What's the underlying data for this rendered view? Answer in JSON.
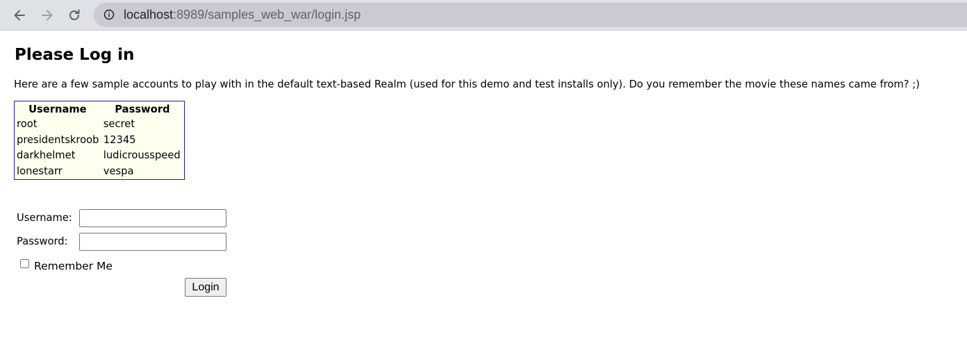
{
  "browser": {
    "url_host": "localhost",
    "url_path": ":8989/samples_web_war/login.jsp",
    "icons": {
      "back": "back-arrow-icon",
      "forward": "forward-arrow-icon",
      "reload": "reload-icon",
      "site_info": "info-icon"
    }
  },
  "page": {
    "title": "Please Log in",
    "intro": "Here are a few sample accounts to play with in the default text-based Realm (used for this demo and test installs only). Do you remember the movie these names came from? ;)",
    "accounts_table": {
      "headers": [
        "Username",
        "Password"
      ],
      "rows": [
        [
          "root",
          "secret"
        ],
        [
          "presidentskroob",
          "12345"
        ],
        [
          "darkhelmet",
          "ludicrousspeed"
        ],
        [
          "lonestarr",
          "vespa"
        ]
      ],
      "border_color": "#1a1aa8",
      "background_color": "#fffff0"
    },
    "form": {
      "username_label": "Username:",
      "username_value": "",
      "password_label": "Password:",
      "password_value": "",
      "remember_label": "Remember Me",
      "remember_checked": false,
      "submit_label": "Login"
    }
  }
}
